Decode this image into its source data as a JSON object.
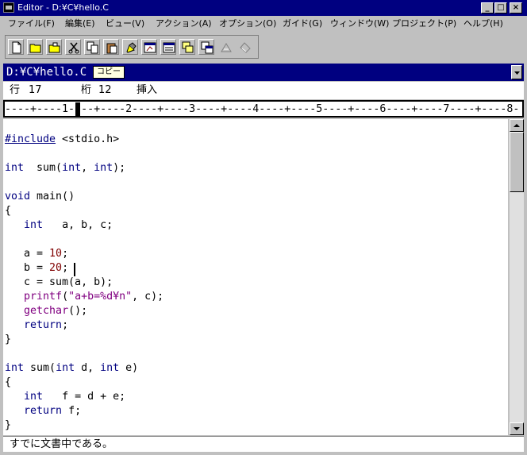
{
  "window": {
    "title": "Editor - D:¥C¥hello.C",
    "minimize_glyph": "_",
    "maximize_glyph": "□",
    "close_glyph": "×"
  },
  "menu": {
    "items": [
      {
        "label": "ファイル(F)"
      },
      {
        "label": "編集(E)"
      },
      {
        "label": "ビュー(V)"
      },
      {
        "label": "アクション(A)"
      },
      {
        "label": "オプション(O)"
      },
      {
        "label": "ガイド(G)"
      },
      {
        "label": "ウィンドウ(W)"
      },
      {
        "label": "プロジェクト(P)"
      },
      {
        "label": "ヘルプ(H)"
      }
    ]
  },
  "toolbar": {
    "buttons": [
      {
        "icon": "new-file-icon"
      },
      {
        "icon": "open-folder-icon"
      },
      {
        "icon": "save-folder-icon"
      },
      {
        "icon": "cut-icon"
      },
      {
        "icon": "copy-icon"
      },
      {
        "icon": "paste-icon"
      },
      {
        "icon": "highlight-icon"
      },
      {
        "icon": "compile-icon"
      },
      {
        "icon": "window-icon"
      },
      {
        "icon": "cascade-icon"
      },
      {
        "icon": "tile-icon"
      },
      {
        "icon": "run-icon"
      },
      {
        "icon": "debug-icon"
      }
    ]
  },
  "file": {
    "path": "D:¥C¥hello.C",
    "tooltip": "コピー"
  },
  "position": {
    "line_label": "行",
    "line_value": "17",
    "col_label": "桁",
    "col_value": "12",
    "mode": "挿入"
  },
  "ruler": {
    "text": "----+----1----+----2----+----3----+----4----+----5----+----6----+----7----+----8-"
  },
  "code": {
    "lines": [
      "",
      "#include <stdio.h>",
      "",
      "int  sum(int, int);",
      "",
      "void main()",
      "{",
      "   int   a, b, c;",
      "",
      "   a = 10;",
      "   b = 20;",
      "   c = sum(a, b);",
      "   printf(\"a+b=%d¥n\", c);",
      "   getchar();",
      "   return;",
      "}",
      "",
      "int sum(int d, int e)",
      "{",
      "   int   f = d + e;",
      "   return f;",
      "}"
    ]
  },
  "status": {
    "message": "すでに文書中である。"
  },
  "colors": {
    "titlebar": "#000080",
    "keyword": "#000080",
    "number": "#800000",
    "string": "#800080"
  }
}
